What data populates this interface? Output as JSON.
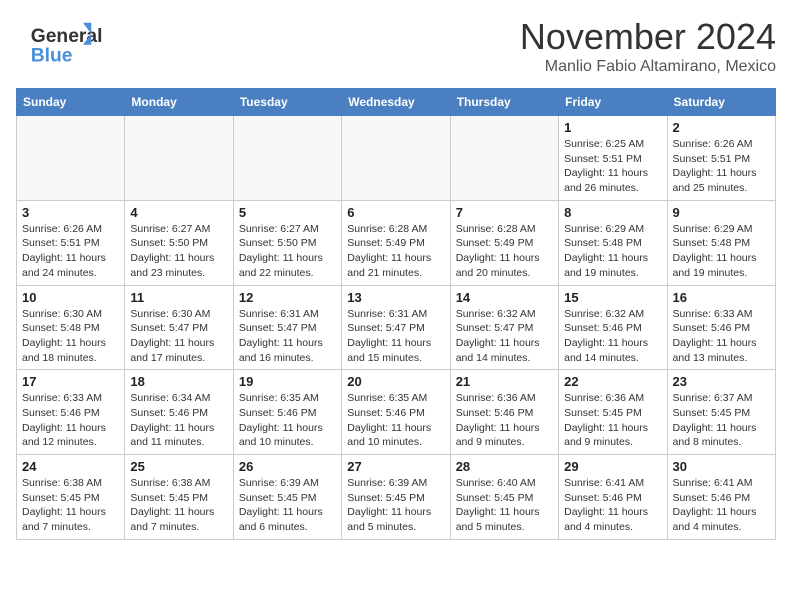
{
  "header": {
    "logo_general": "General",
    "logo_blue": "Blue",
    "month_title": "November 2024",
    "location": "Manlio Fabio Altamirano, Mexico"
  },
  "days_of_week": [
    "Sunday",
    "Monday",
    "Tuesday",
    "Wednesday",
    "Thursday",
    "Friday",
    "Saturday"
  ],
  "weeks": [
    [
      {
        "day": "",
        "info": ""
      },
      {
        "day": "",
        "info": ""
      },
      {
        "day": "",
        "info": ""
      },
      {
        "day": "",
        "info": ""
      },
      {
        "day": "",
        "info": ""
      },
      {
        "day": "1",
        "info": "Sunrise: 6:25 AM\nSunset: 5:51 PM\nDaylight: 11 hours and 26 minutes."
      },
      {
        "day": "2",
        "info": "Sunrise: 6:26 AM\nSunset: 5:51 PM\nDaylight: 11 hours and 25 minutes."
      }
    ],
    [
      {
        "day": "3",
        "info": "Sunrise: 6:26 AM\nSunset: 5:51 PM\nDaylight: 11 hours and 24 minutes."
      },
      {
        "day": "4",
        "info": "Sunrise: 6:27 AM\nSunset: 5:50 PM\nDaylight: 11 hours and 23 minutes."
      },
      {
        "day": "5",
        "info": "Sunrise: 6:27 AM\nSunset: 5:50 PM\nDaylight: 11 hours and 22 minutes."
      },
      {
        "day": "6",
        "info": "Sunrise: 6:28 AM\nSunset: 5:49 PM\nDaylight: 11 hours and 21 minutes."
      },
      {
        "day": "7",
        "info": "Sunrise: 6:28 AM\nSunset: 5:49 PM\nDaylight: 11 hours and 20 minutes."
      },
      {
        "day": "8",
        "info": "Sunrise: 6:29 AM\nSunset: 5:48 PM\nDaylight: 11 hours and 19 minutes."
      },
      {
        "day": "9",
        "info": "Sunrise: 6:29 AM\nSunset: 5:48 PM\nDaylight: 11 hours and 19 minutes."
      }
    ],
    [
      {
        "day": "10",
        "info": "Sunrise: 6:30 AM\nSunset: 5:48 PM\nDaylight: 11 hours and 18 minutes."
      },
      {
        "day": "11",
        "info": "Sunrise: 6:30 AM\nSunset: 5:47 PM\nDaylight: 11 hours and 17 minutes."
      },
      {
        "day": "12",
        "info": "Sunrise: 6:31 AM\nSunset: 5:47 PM\nDaylight: 11 hours and 16 minutes."
      },
      {
        "day": "13",
        "info": "Sunrise: 6:31 AM\nSunset: 5:47 PM\nDaylight: 11 hours and 15 minutes."
      },
      {
        "day": "14",
        "info": "Sunrise: 6:32 AM\nSunset: 5:47 PM\nDaylight: 11 hours and 14 minutes."
      },
      {
        "day": "15",
        "info": "Sunrise: 6:32 AM\nSunset: 5:46 PM\nDaylight: 11 hours and 14 minutes."
      },
      {
        "day": "16",
        "info": "Sunrise: 6:33 AM\nSunset: 5:46 PM\nDaylight: 11 hours and 13 minutes."
      }
    ],
    [
      {
        "day": "17",
        "info": "Sunrise: 6:33 AM\nSunset: 5:46 PM\nDaylight: 11 hours and 12 minutes."
      },
      {
        "day": "18",
        "info": "Sunrise: 6:34 AM\nSunset: 5:46 PM\nDaylight: 11 hours and 11 minutes."
      },
      {
        "day": "19",
        "info": "Sunrise: 6:35 AM\nSunset: 5:46 PM\nDaylight: 11 hours and 10 minutes."
      },
      {
        "day": "20",
        "info": "Sunrise: 6:35 AM\nSunset: 5:46 PM\nDaylight: 11 hours and 10 minutes."
      },
      {
        "day": "21",
        "info": "Sunrise: 6:36 AM\nSunset: 5:46 PM\nDaylight: 11 hours and 9 minutes."
      },
      {
        "day": "22",
        "info": "Sunrise: 6:36 AM\nSunset: 5:45 PM\nDaylight: 11 hours and 9 minutes."
      },
      {
        "day": "23",
        "info": "Sunrise: 6:37 AM\nSunset: 5:45 PM\nDaylight: 11 hours and 8 minutes."
      }
    ],
    [
      {
        "day": "24",
        "info": "Sunrise: 6:38 AM\nSunset: 5:45 PM\nDaylight: 11 hours and 7 minutes."
      },
      {
        "day": "25",
        "info": "Sunrise: 6:38 AM\nSunset: 5:45 PM\nDaylight: 11 hours and 7 minutes."
      },
      {
        "day": "26",
        "info": "Sunrise: 6:39 AM\nSunset: 5:45 PM\nDaylight: 11 hours and 6 minutes."
      },
      {
        "day": "27",
        "info": "Sunrise: 6:39 AM\nSunset: 5:45 PM\nDaylight: 11 hours and 5 minutes."
      },
      {
        "day": "28",
        "info": "Sunrise: 6:40 AM\nSunset: 5:45 PM\nDaylight: 11 hours and 5 minutes."
      },
      {
        "day": "29",
        "info": "Sunrise: 6:41 AM\nSunset: 5:46 PM\nDaylight: 11 hours and 4 minutes."
      },
      {
        "day": "30",
        "info": "Sunrise: 6:41 AM\nSunset: 5:46 PM\nDaylight: 11 hours and 4 minutes."
      }
    ]
  ]
}
